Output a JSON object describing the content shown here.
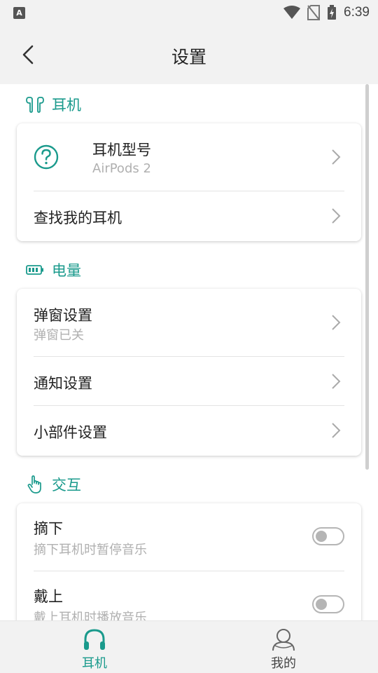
{
  "status_bar": {
    "time": "6:39",
    "app_badge": "A"
  },
  "header": {
    "title": "设置"
  },
  "sections": [
    {
      "title": "耳机",
      "icon": "earbuds-icon",
      "rows": [
        {
          "title": "耳机型号",
          "subtitle": "AirPods 2",
          "icon": "help-circle-icon"
        },
        {
          "title": "查找我的耳机"
        }
      ]
    },
    {
      "title": "电量",
      "icon": "battery-icon",
      "rows": [
        {
          "title": "弹窗设置",
          "subtitle": "弹窗已关"
        },
        {
          "title": "通知设置"
        },
        {
          "title": "小部件设置"
        }
      ]
    },
    {
      "title": "交互",
      "icon": "hand-tap-icon",
      "rows": [
        {
          "title": "摘下",
          "subtitle": "摘下耳机时暂停音乐",
          "toggle_on": false
        },
        {
          "title": "戴上",
          "subtitle": "戴上耳机时播放音乐",
          "toggle_on": false
        }
      ]
    }
  ],
  "bottom_nav": [
    {
      "label": "耳机",
      "icon": "headphones-icon",
      "active": true
    },
    {
      "label": "我的",
      "icon": "person-icon",
      "active": false
    }
  ],
  "colors": {
    "accent": "#1a9a8c",
    "inactive": "#555555",
    "subtitle": "#b0b0b0"
  }
}
